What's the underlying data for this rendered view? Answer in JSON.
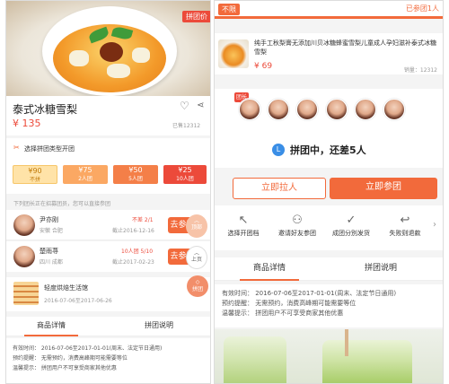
{
  "left": {
    "badge": "拼团价",
    "product": {
      "title": "泰式冰糖雪梨",
      "price": "¥ 135",
      "sold": "已售12312"
    },
    "type_title": "选择拼团类型开团",
    "options": [
      {
        "price": "¥90",
        "label": "不拼"
      },
      {
        "price": "¥75",
        "label": "2人团"
      },
      {
        "price": "¥50",
        "label": "5人团"
      },
      {
        "price": "¥25",
        "label": "10人团"
      }
    ],
    "join_hint": "下列团长正在招募团员，您可以直接参团",
    "groups": [
      {
        "name": "尹亦刚",
        "place": "安徽 合肥",
        "status": "不差 2/1",
        "deadline": "截止2016-12-16",
        "btn": "去参团",
        "float": "顶部"
      },
      {
        "name": "楚雨荨",
        "place": "四川 成都",
        "status": "10人团 5/10",
        "deadline": "截止2017-02-23",
        "btn": "去参团",
        "float": "上页"
      }
    ],
    "shop": {
      "name": "轻度烘焙生活馆",
      "time": "2016-07-06至2017-06-26",
      "coupon": "拼团"
    },
    "tabs": [
      "商品详情",
      "拼团说明"
    ],
    "info": [
      "有效时间： 2016-07-06至2017-01-01(周末、法定节日通用)",
      "预约提醒： 无需预约，消费高峰期可能需要等位",
      "温馨提示： 拼团用户不可享受商家其他优惠"
    ]
  },
  "right": {
    "flag": "不限",
    "joined": "已参团1人",
    "item": {
      "title": "纯手工秋梨膏无添加川贝冰糖蜂蜜雪梨儿童成人孕妇滋补泰式冰糖雪梨",
      "price": "¥ 69",
      "sales": "销量：12312"
    },
    "leader_tag": "团长",
    "status": "拼团中，还差5人",
    "status_icon": "clock-icon",
    "btn_invite": "立即拉人",
    "btn_join": "立即参团",
    "steps": [
      {
        "label": "选择开团档",
        "icon": "cursor-icon"
      },
      {
        "label": "邀请好友参团",
        "icon": "user-icon"
      },
      {
        "label": "成团分別发货",
        "icon": "check-icon"
      },
      {
        "label": "失败则退款",
        "icon": "refund-icon"
      }
    ],
    "tabs": [
      "商品详情",
      "拼团说明"
    ],
    "info": [
      "有效时间：  2016-07-06至2017-01-01(周末、法定节日通用)",
      "预约提醒：  无需预约，消费高峰期可能需要等位",
      "温馨提示：  拼团用户不可享受商家其他优惠"
    ]
  },
  "colors": {
    "accent": "#f26a3b",
    "red": "#ec4a3a",
    "gold": "#f6c66a"
  }
}
